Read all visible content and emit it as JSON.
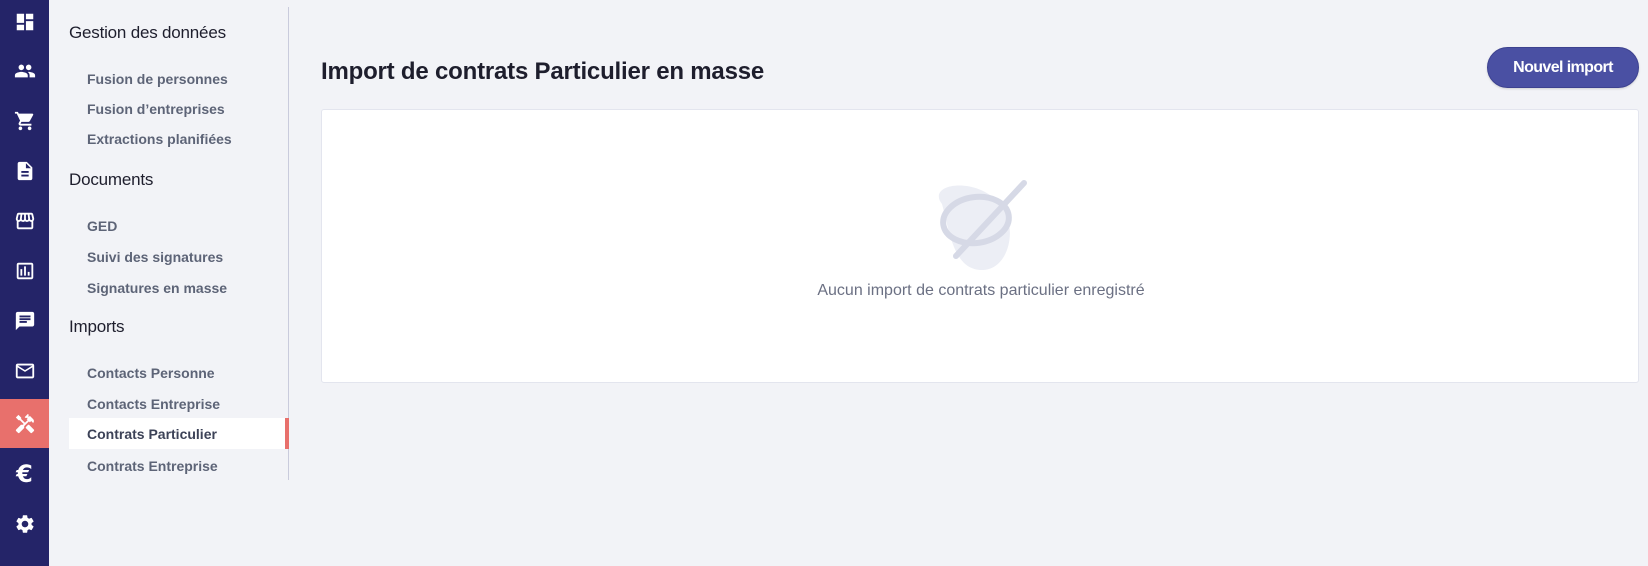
{
  "page": {
    "title": "Import de contrats Particulier en masse",
    "new_import_label": "Nouvel import",
    "empty_message": "Aucun import de contrats particulier enregistré"
  },
  "rail": [
    {
      "icon": "dashboard-icon",
      "active": false
    },
    {
      "icon": "people-icon",
      "active": false
    },
    {
      "icon": "cart-icon",
      "active": false
    },
    {
      "icon": "document-icon",
      "active": false
    },
    {
      "icon": "store-icon",
      "active": false
    },
    {
      "icon": "chart-icon",
      "active": false
    },
    {
      "icon": "chat-icon",
      "active": false
    },
    {
      "icon": "mail-icon",
      "active": false
    },
    {
      "icon": "tools-icon",
      "active": true
    },
    {
      "icon": "euro-icon",
      "active": false
    },
    {
      "icon": "settings-icon",
      "active": false
    }
  ],
  "submenu": {
    "groups": [
      {
        "title": "Gestion des données",
        "items": [
          "Fusion de personnes",
          "Fusion d’entreprises",
          "Extractions planifiées"
        ]
      },
      {
        "title": "Documents",
        "items": [
          "GED",
          "Suivi des signatures",
          "Signatures en masse"
        ]
      },
      {
        "title": "Imports",
        "items": [
          "Contacts Personne",
          "Contacts Entreprise",
          "Contrats Particulier",
          "Contrats Entreprise"
        ]
      }
    ],
    "active_item": "Contrats Particulier"
  },
  "colors": {
    "rail_bg": "#242468",
    "accent": "#e8706c",
    "button": "#4a50a3",
    "background": "#f2f3f7"
  }
}
